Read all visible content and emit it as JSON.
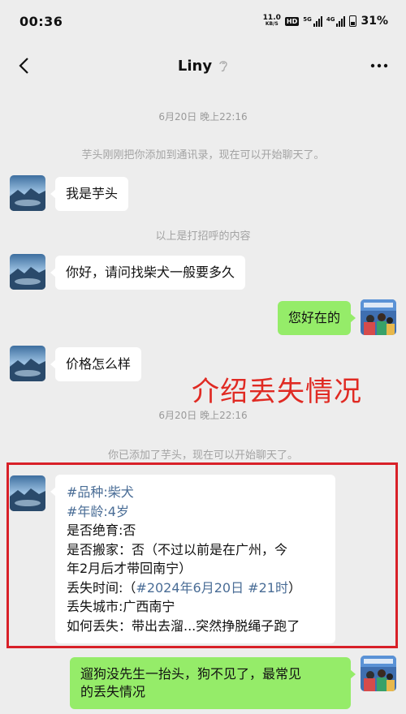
{
  "status_bar": {
    "time": "00:36",
    "net_speed_value": "11.0",
    "net_speed_unit": "KB/S",
    "hd_label": "HD",
    "sig1_label": "5G",
    "sig2_label": "4G",
    "battery_percent": "31%",
    "icons": [
      "hd-icon",
      "signal-5g-icon",
      "signal-4g-icon",
      "battery-icon"
    ]
  },
  "nav": {
    "title": "Liny",
    "back_icon": "chevron-left-icon",
    "ear_icon": "ear-icon",
    "more_icon": "more-dots-icon"
  },
  "chat": {
    "time_1": "6月20日 晚上22:16",
    "system_1": "芋头刚刚把你添加到通讯录，现在可以开始聊天了。",
    "msg_1": "我是芋头",
    "system_2": "以上是打招呼的内容",
    "msg_2": "你好，请问找柴犬一般要多久",
    "msg_3_me": "您好在的",
    "msg_4": "价格怎么样",
    "time_2": "6月20日 晚上22:16",
    "system_3": "你已添加了芋头，现在可以开始聊天了。",
    "long_msg": {
      "line_1": "#品种:柴犬",
      "line_2": "#年龄:4岁",
      "line_3": "是否绝育:否",
      "line_4a": "是否搬家：否（不过以前是在广州，今",
      "line_4b": "年2月后才带回南宁）",
      "line_5_prefix": "丢失时间:（",
      "line_5_hash1": "#2024年6月20日",
      "line_5_hash2": "#21时",
      "line_5_suffix": "）",
      "line_6": "丢失城市:广西南宁",
      "line_7": "如何丢失：带出去溜...突然挣脱绳子跑了"
    },
    "msg_5_me_a": "遛狗没先生一抬头，狗不见了，最常见",
    "msg_5_me_b": "的丢失情况"
  },
  "annotation": {
    "text": "介绍丢失情况",
    "color": "#e02a23"
  },
  "colors": {
    "background": "#ededed",
    "bubble_me": "#95ec69",
    "bubble_other": "#ffffff",
    "hashtag": "#4a6d96",
    "highlight_box": "#d82028"
  }
}
